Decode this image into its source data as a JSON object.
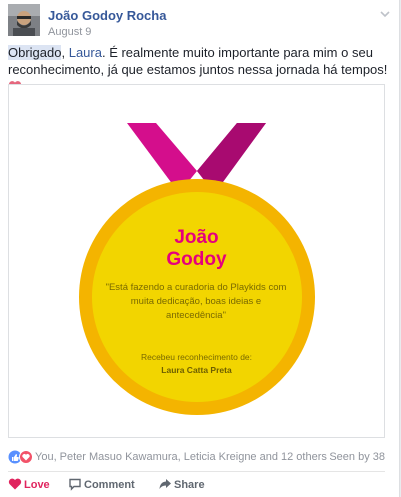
{
  "post": {
    "author": "João Godoy Rocha",
    "date": "August 9",
    "text_parts": {
      "highlighted": "Obrigado",
      "comma1": ", ",
      "mention": "Laura",
      "rest": ". É realmente muito importante para mim o seu reconhecimento, já que estamos juntos nessa jornada há tempos!"
    }
  },
  "medal": {
    "name_line1": "João",
    "name_line2": "Godoy",
    "quote": "\"Está fazendo a curadoria do Playkids com muita dedicação, boas ideias e antecedência\"",
    "received_label": "Recebeu reconhecimento de:",
    "received_from": "Laura Catta Preta",
    "colors": {
      "ribbon": "#d40e8c",
      "ribbon_dark": "#a80a70",
      "medal_outer": "#f4b400",
      "medal_inner": "#f2d500",
      "name": "#e5007d"
    }
  },
  "reactions": {
    "icons": [
      "like-reaction",
      "love-reaction"
    ],
    "summary": "You, Peter Masuo Kawamura, Leticia Kreigne and 12 others",
    "seen_by": "Seen by 38"
  },
  "actions": {
    "love": "Love",
    "comment": "Comment",
    "share": "Share"
  }
}
